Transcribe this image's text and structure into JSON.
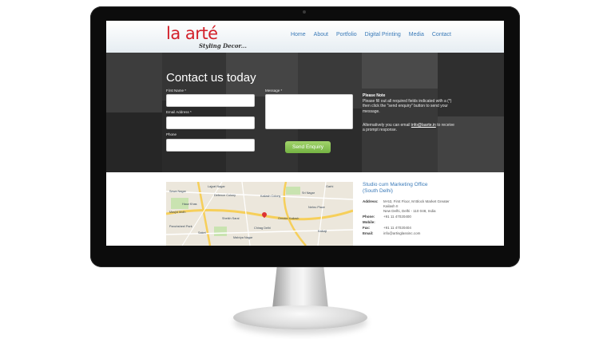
{
  "brand": {
    "logo": "la arté",
    "tagline": "Styling Decor..."
  },
  "nav": [
    "Home",
    "About",
    "Portfolio",
    "Digital Printing",
    "Media",
    "Contact"
  ],
  "contact": {
    "title": "Contact us today",
    "first_name_label": "First Name *",
    "email_label": "Email Address *",
    "phone_label": "Phone",
    "message_label": "Message *",
    "send_label": "Send Enquiry",
    "note_title": "Please Note",
    "note_text": "Please fill out all required fields indicated with a (*) then click the \"send enquiry\" button to send your message.",
    "alt_prefix": "Alternatively you can email ",
    "alt_email": "info@laarte.in",
    "alt_suffix": " to receive a prompt response."
  },
  "office": {
    "title_line1": "Studio cum Marketing Office",
    "title_line2": "(South Delhi)",
    "address_label": "Address:",
    "address_line1": "M-53, First Floor, M Block Market Greater",
    "address_line2": "Kailash II",
    "address_line3": "New Delhi, Delhi - 110 048, India",
    "phone_label": "Phone:",
    "phone": "+91 11 47020400",
    "mobile_label": "Mobile:",
    "mobile": "",
    "fax_label": "Fax:",
    "fax": "+91 11 47020404",
    "email_label": "Email:",
    "email": "info@artisglassinc.com"
  },
  "map_labels": [
    "Lajpat Nagar",
    "Sewa Nagar",
    "Defence Colony",
    "Kailash Colony",
    "Greater Kailash",
    "Masjid Moth",
    "Chirag Delhi",
    "Sheikh Sarai",
    "Saket",
    "Malviya Nagar",
    "Panchsheel Park",
    "Hauz Khas",
    "Nehru Place",
    "Kalkaji",
    "Sri Nagar",
    "Garhi"
  ],
  "colors": {
    "accent": "#3a7ab8",
    "brand_red": "#d3202a",
    "send_green": "#86c253",
    "band_bg": "#2e2e2e"
  }
}
